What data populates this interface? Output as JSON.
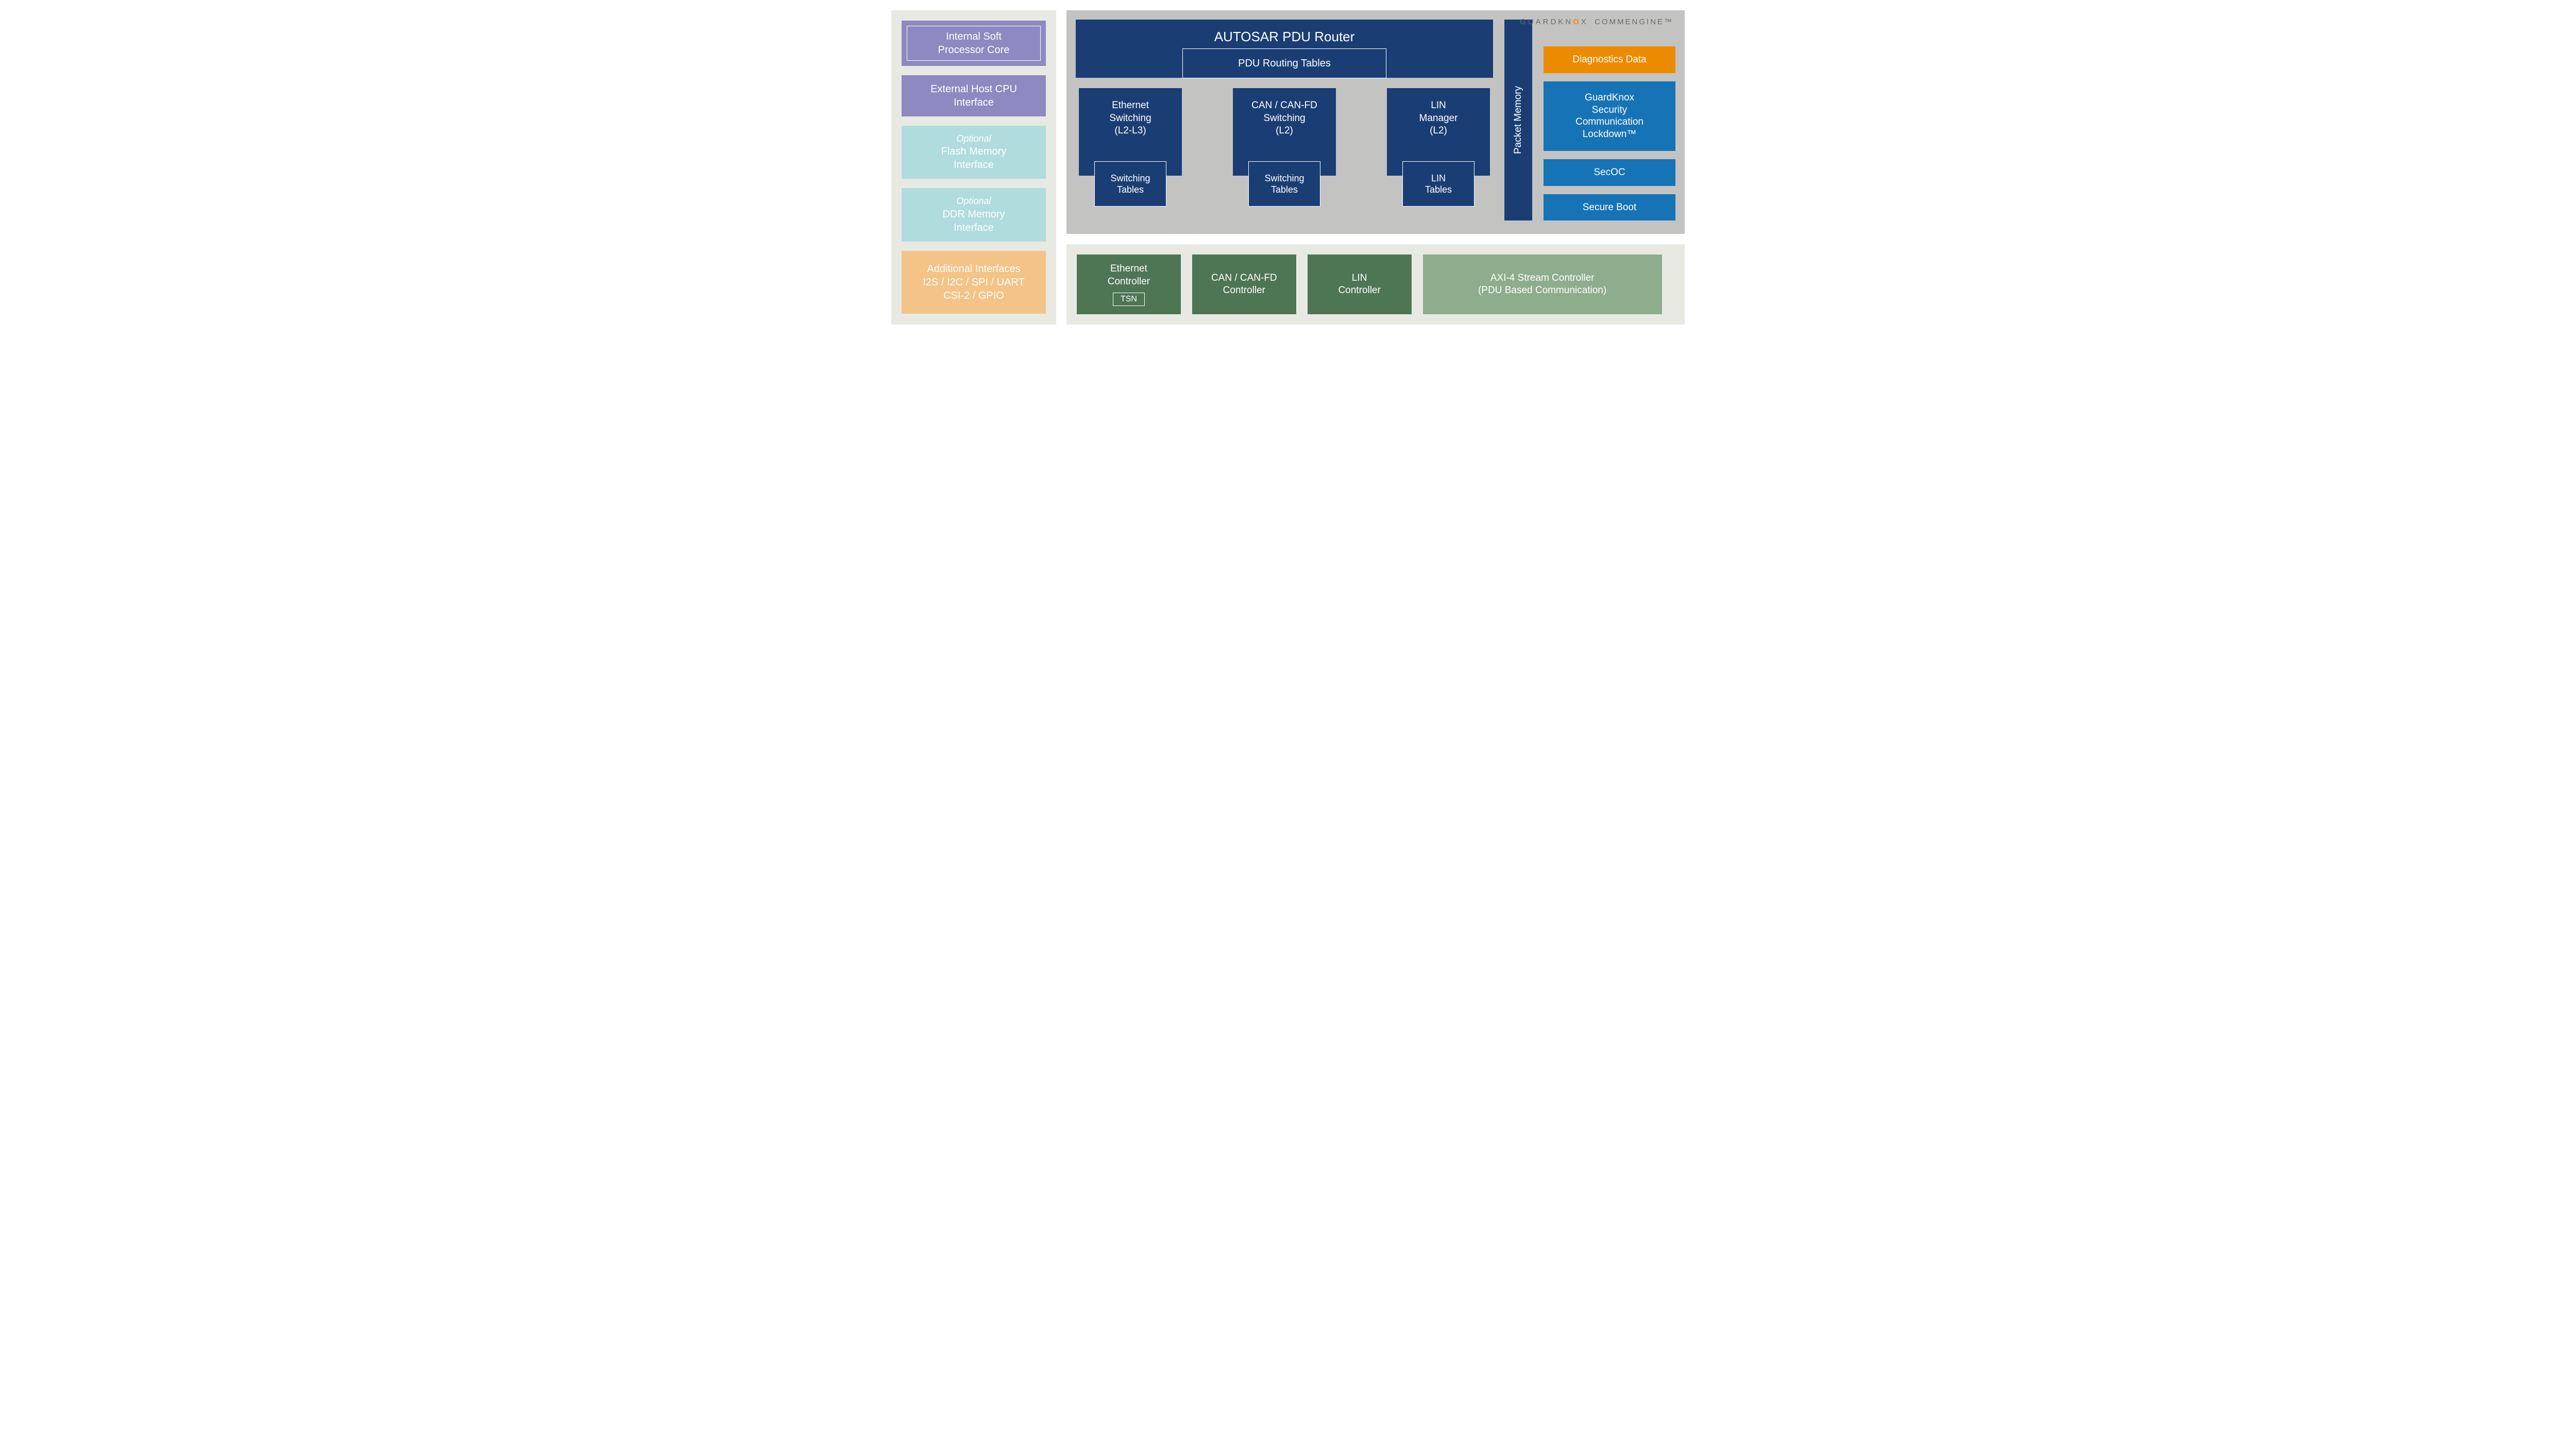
{
  "brand": {
    "part1": "GUARDKN",
    "o": "O",
    "part2": "X",
    "part3": "COMMENGINE™"
  },
  "left": {
    "internal_soft": "Internal Soft\nProcessor Core",
    "external_host": "External Host CPU\nInterface",
    "flash_opt_label": "Optional",
    "flash": "Flash Memory\nInterface",
    "ddr_opt_label": "Optional",
    "ddr": "DDR Memory\nInterface",
    "additional": "Additional Interfaces\nI2S / I2C / SPI / UART\nCSI-2 / GPIO"
  },
  "router": {
    "title": "AUTOSAR PDU Router",
    "tables": "PDU Routing Tables"
  },
  "switches": [
    {
      "title": "Ethernet\nSwitching\n(L2-L3)",
      "sub": "Switching\nTables"
    },
    {
      "title": "CAN / CAN-FD\nSwitching\n(L2)",
      "sub": "Switching\nTables"
    },
    {
      "title": "LIN\nManager\n(L2)",
      "sub": "LIN\nTables"
    }
  ],
  "packet_memory": "Packet Memory",
  "right": {
    "diag": "Diagnostics Data",
    "lockdown": "GuardKnox\nSecurity\nCommunication\nLockdown™",
    "secoc": "SecOC",
    "secure_boot": "Secure Boot"
  },
  "controllers": {
    "eth": "Ethernet\nController",
    "tsn": "TSN",
    "can": "CAN / CAN-FD\nController",
    "lin": "LIN\nController",
    "axi": "AXI-4 Stream Controller\n(PDU Based Communication)"
  }
}
